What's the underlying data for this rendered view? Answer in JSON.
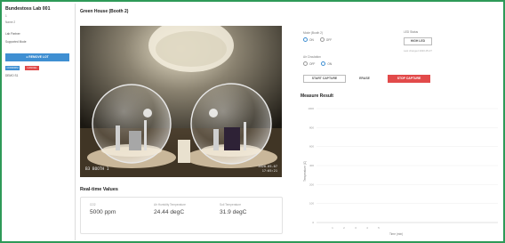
{
  "sidebar": {
    "title": "Bundestoss Lab 001",
    "line1": "1",
    "line2": "Name 2",
    "field1": "Lab Partner",
    "field2": "Supported Mode",
    "primary_button": "REMOVE LOT",
    "chip_blue": "CONFIRM",
    "chip_red": "CANCEL",
    "footer": "DEMO S1"
  },
  "center": {
    "title": "Green House (Booth 2)",
    "camera": {
      "label": "B3 BOOTH 1",
      "time_line1": "2020-05-07",
      "time_line2": "17:05:21"
    }
  },
  "realtime": {
    "title": "Real-time Values",
    "items": [
      {
        "label": "CO2",
        "value": "5000 ppm"
      },
      {
        "label": "Air Humidity Temperature",
        "value": "24.44 degC"
      },
      {
        "label": "Soil Temperature",
        "value": "31.9 degC"
      }
    ]
  },
  "right": {
    "mode_label": "Mode (Booth 2)",
    "mode_options": [
      "ON",
      "OFF"
    ],
    "mode_selected": 0,
    "air_label": "Air Circulation",
    "air_options": [
      "OFF",
      "ON"
    ],
    "air_selected": 1,
    "led_label": "LED Status",
    "led_button": "HIGH LED",
    "led_note": "Last changed 2020-05-07",
    "start_button": "START CAPTURE",
    "erase_button": "ERASE",
    "stop_button": "STOP CAPTURE",
    "measure_title": "Measure Result"
  },
  "chart_data": {
    "type": "line",
    "title": "",
    "xlabel": "Time (min)",
    "ylabel": "Temperature (C)",
    "y_ticks": [
      "1000",
      "800",
      "600",
      "400",
      "200",
      "100",
      "0"
    ],
    "x_ticks": [
      "1",
      "2",
      "3",
      "4",
      "5"
    ],
    "grid": true,
    "series": []
  },
  "colors": {
    "frame": "#2e9a58",
    "primary": "#3f8fd2",
    "danger": "#e24a4a"
  }
}
